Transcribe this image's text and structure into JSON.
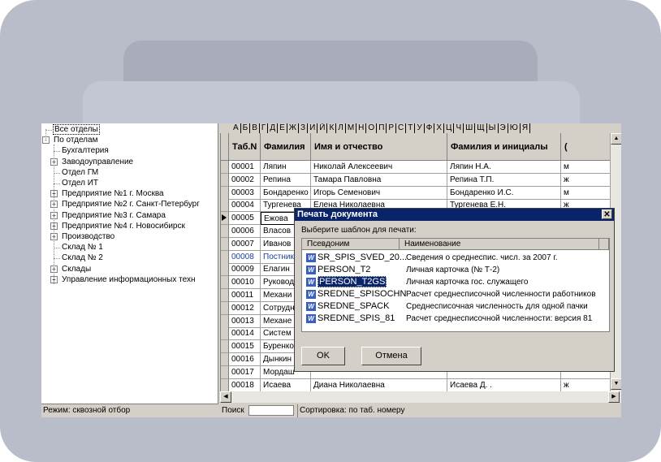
{
  "tree": {
    "items": [
      {
        "label": "Все отделы",
        "expander": ""
      },
      {
        "label": "По отделам",
        "expander": "-"
      },
      {
        "label": "Бухгалтерия",
        "expander": ""
      },
      {
        "label": "Заводоуправление",
        "expander": "+"
      },
      {
        "label": "Отдел ГМ",
        "expander": ""
      },
      {
        "label": "Отдел ИТ",
        "expander": ""
      },
      {
        "label": "Предприятие №1 г. Москва",
        "expander": "+"
      },
      {
        "label": "Предприятие №2 г. Санкт-Петербург",
        "expander": "+"
      },
      {
        "label": "Предприятие №3 г. Самара",
        "expander": "+"
      },
      {
        "label": "Предприятие №4 г. Новосибирск",
        "expander": "+"
      },
      {
        "label": "Производство",
        "expander": "+"
      },
      {
        "label": "Склад № 1",
        "expander": ""
      },
      {
        "label": "Склад № 2",
        "expander": ""
      },
      {
        "label": "Склады",
        "expander": "+"
      },
      {
        "label": "Управление информационных техн",
        "expander": "+"
      }
    ],
    "status": "Режим: сквозной отбор"
  },
  "alphabet": [
    "А",
    "Б",
    "В",
    "Г",
    "Д",
    "Е",
    "Ж",
    "З",
    "И",
    "Й",
    "К",
    "Л",
    "М",
    "Н",
    "О",
    "П",
    "Р",
    "С",
    "Т",
    "У",
    "Ф",
    "Х",
    "Ц",
    "Ч",
    "Ш",
    "Щ",
    "Ы",
    "Э",
    "Ю",
    "Я"
  ],
  "grid": {
    "headers": [
      "Таб.N",
      "Фамилия",
      "Имя и отчество",
      "Фамилия и инициалы",
      "("
    ],
    "rows": [
      [
        "00001",
        "Ляпин",
        "Николай Алексеевич",
        "Ляпин Н.А.",
        "м"
      ],
      [
        "00002",
        "Репина",
        "Тамара Павловна",
        "Репина Т.П.",
        "ж"
      ],
      [
        "00003",
        "Бондаренко",
        "Игорь Семенович",
        "Бондаренко И.С.",
        "м"
      ],
      [
        "00004",
        "Тургенева",
        "Елена Николаевна",
        "Тургенева Е.Н.",
        "ж"
      ],
      [
        "00005",
        "Ежова",
        "",
        "",
        ""
      ],
      [
        "00006",
        "Власов",
        "",
        "",
        ""
      ],
      [
        "00007",
        "Иванов",
        "",
        "",
        ""
      ],
      [
        "00008",
        "Постник",
        "",
        "",
        ""
      ],
      [
        "00009",
        "Елагин",
        "",
        "",
        ""
      ],
      [
        "00010",
        "Руковод",
        "",
        "",
        ""
      ],
      [
        "00011",
        "Механи",
        "",
        "",
        ""
      ],
      [
        "00012",
        "Сотрудн",
        "",
        "",
        ""
      ],
      [
        "00013",
        "Механе",
        "",
        "",
        ""
      ],
      [
        "00014",
        "Систем",
        "",
        "",
        ""
      ],
      [
        "00015",
        "Буренко",
        "",
        "",
        ""
      ],
      [
        "00016",
        "Дынкин",
        "",
        "",
        ""
      ],
      [
        "00017",
        "Мордаш",
        "",
        "",
        ""
      ],
      [
        "00018",
        "Исаева",
        "Диана  Николаевна",
        "Исаева Д. .",
        "ж"
      ]
    ],
    "current_row_index": 4,
    "highlight_row_index": 7
  },
  "status_bar": {
    "search_label": "Поиск",
    "search_value": "",
    "sort_text": "Сортировка: по таб. номеру"
  },
  "dialog": {
    "title": "Печать документа",
    "close": "✕",
    "prompt": "Выберите шаблон для печати:",
    "col_alias": "Псевдоним",
    "col_name": "Наименование",
    "icon_glyph": "W",
    "items": [
      {
        "alias": "SR_SPIS_SVED_20...",
        "name": "Сведения о среднеспис. числ. за 2007 г."
      },
      {
        "alias": "PERSON_T2",
        "name": "Личная карточка (№ Т-2)"
      },
      {
        "alias": "PERSON_T2GS",
        "name": "Личная карточка гос. служащего"
      },
      {
        "alias": "SREDNE_SPISOCHN",
        "name": "Расчет среднесписочной численности работников"
      },
      {
        "alias": "SREDNE_SPACK",
        "name": "Среднесписочная численность для одной пачки"
      },
      {
        "alias": "SREDNE_SPIS_81",
        "name": "Расчет среднесписочной численности: версия 81"
      }
    ],
    "selected_index": 2,
    "ok_label": "OK",
    "cancel_label": "Отмена"
  },
  "colors": {
    "frame": "#b9bcc9",
    "titlebar": "#0a246a",
    "selection": "#0a246a"
  }
}
